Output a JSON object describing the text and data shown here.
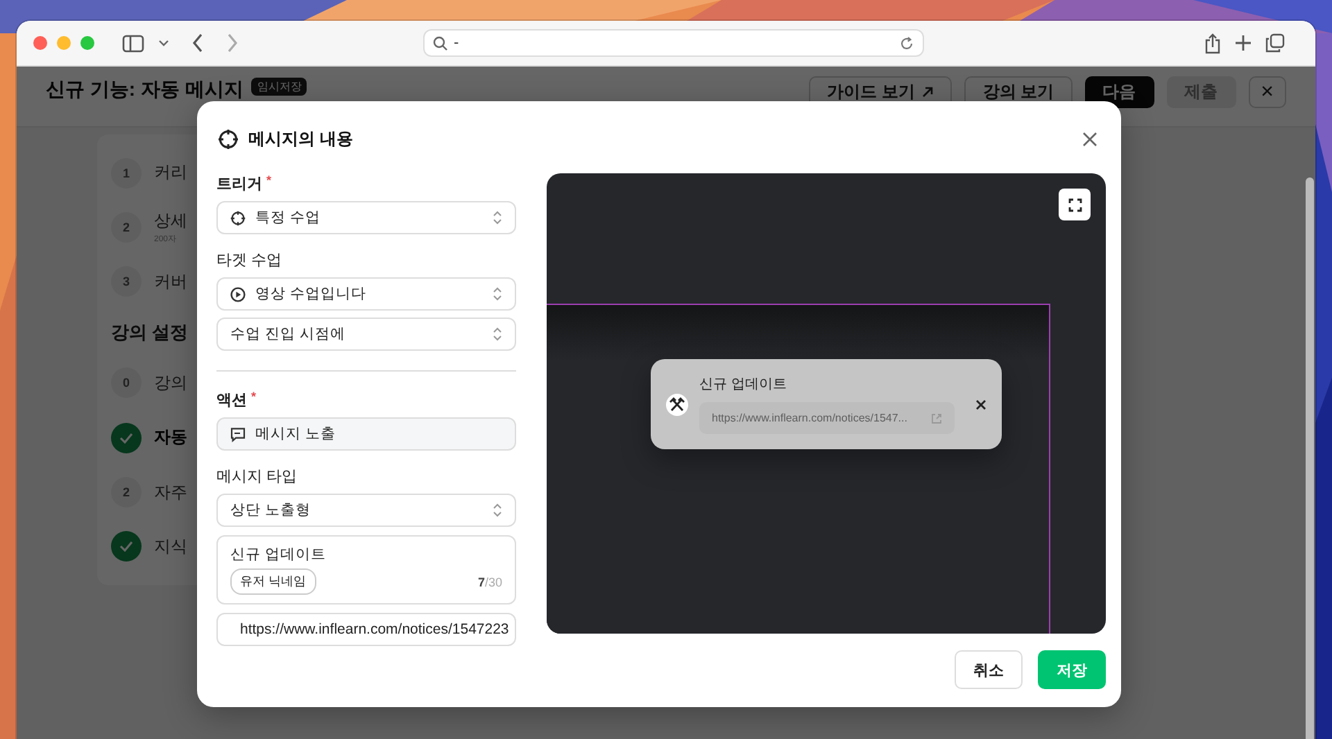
{
  "browser": {
    "address": "-"
  },
  "page": {
    "title": "신규 기능: 자동 메시지",
    "badge": "임시저장",
    "buttons": [
      {
        "label": "가이드 보기",
        "kind": "link"
      },
      {
        "label": "강의 보기",
        "kind": "outline"
      },
      {
        "label": "다음",
        "kind": "primary"
      },
      {
        "label": "제출",
        "kind": "disabled"
      },
      {
        "label": "×",
        "kind": "close"
      }
    ]
  },
  "sidebar": {
    "steps": [
      {
        "number": "1",
        "label": "커리",
        "done": false
      },
      {
        "number": "2",
        "label": "상세",
        "sub": "200자",
        "done": false
      },
      {
        "number": "3",
        "label": "커버",
        "done": false
      }
    ],
    "section": "강의 설정",
    "settings": [
      {
        "number": "0",
        "label": "강의",
        "done": false,
        "selected": false
      },
      {
        "label": "자동",
        "done": true,
        "selected": true
      },
      {
        "number": "2",
        "label": "자주",
        "done": false,
        "selected": false
      },
      {
        "label": "지식",
        "done": true,
        "selected": false
      }
    ]
  },
  "modal": {
    "title": "메시지의 내용",
    "trigger": {
      "label": "트리거",
      "mark": "*",
      "value": "특정 수업"
    },
    "target": {
      "label": "타겟 수업",
      "value": "영상 수업입니다",
      "timing": "수업 진입 시점에"
    },
    "action": {
      "label": "액션",
      "mark": "*",
      "value": "메시지 노출"
    },
    "message_type": {
      "label": "메시지 타입",
      "value": "상단 노출형"
    },
    "message": {
      "text": "신규 업데이트",
      "tag": "유저 닉네임",
      "count": "**7**/30"
    },
    "link": {
      "value": "https://www.inflearn.com/notices/1547223"
    },
    "preview": {
      "title": "신규 업데이트",
      "url": "https://www.inflearn.com/notices/1547..."
    },
    "cancel": "취소",
    "save": "저장"
  }
}
